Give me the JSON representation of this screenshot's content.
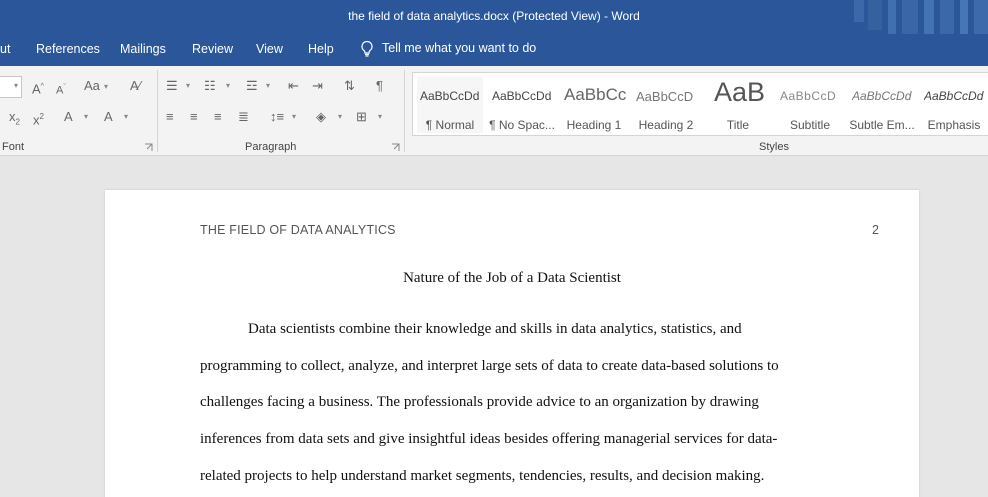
{
  "window": {
    "title": "the field of data analytics.docx (Protected View)  -  Word"
  },
  "ribbon_tabs": [
    {
      "label": "ut"
    },
    {
      "label": "References"
    },
    {
      "label": "Mailings"
    },
    {
      "label": "Review"
    },
    {
      "label": "View"
    },
    {
      "label": "Help"
    }
  ],
  "tell_me": {
    "label": "Tell me what you want to do"
  },
  "groups": {
    "font": "Font",
    "paragraph": "Paragraph",
    "styles": "Styles"
  },
  "styles": [
    {
      "sample": "AaBbCcDd",
      "name": "¶ Normal"
    },
    {
      "sample": "AaBbCcDd",
      "name": "¶ No Spac..."
    },
    {
      "sample": "AaBbCc",
      "name": "Heading 1"
    },
    {
      "sample": "AaBbCcD",
      "name": "Heading 2"
    },
    {
      "sample": "AaB",
      "name": "Title"
    },
    {
      "sample": "AaBbCcD",
      "name": "Subtitle"
    },
    {
      "sample": "AaBbCcDd",
      "name": "Subtle Em..."
    },
    {
      "sample": "AaBbCcDd",
      "name": "Emphasis"
    }
  ],
  "document": {
    "running_header": "THE FIELD OF DATA ANALYTICS",
    "page_number": "2",
    "heading": "Nature of the Job of a Data Scientist",
    "paragraph_lines": [
      "Data scientists combine their knowledge and skills in data analytics, statistics, and",
      "programming to collect, analyze, and interpret large sets of data to create data-based solutions to",
      "challenges facing a business. The professionals provide advice to an organization by drawing",
      "inferences from data sets and give insightful ideas besides offering managerial services for data-",
      "related projects to help understand market segments, tendencies, results, and decision making."
    ]
  },
  "colors": {
    "title_bar": "#2b579a",
    "ribbon": "#f3f3f3",
    "canvas": "#e6e6e6"
  }
}
